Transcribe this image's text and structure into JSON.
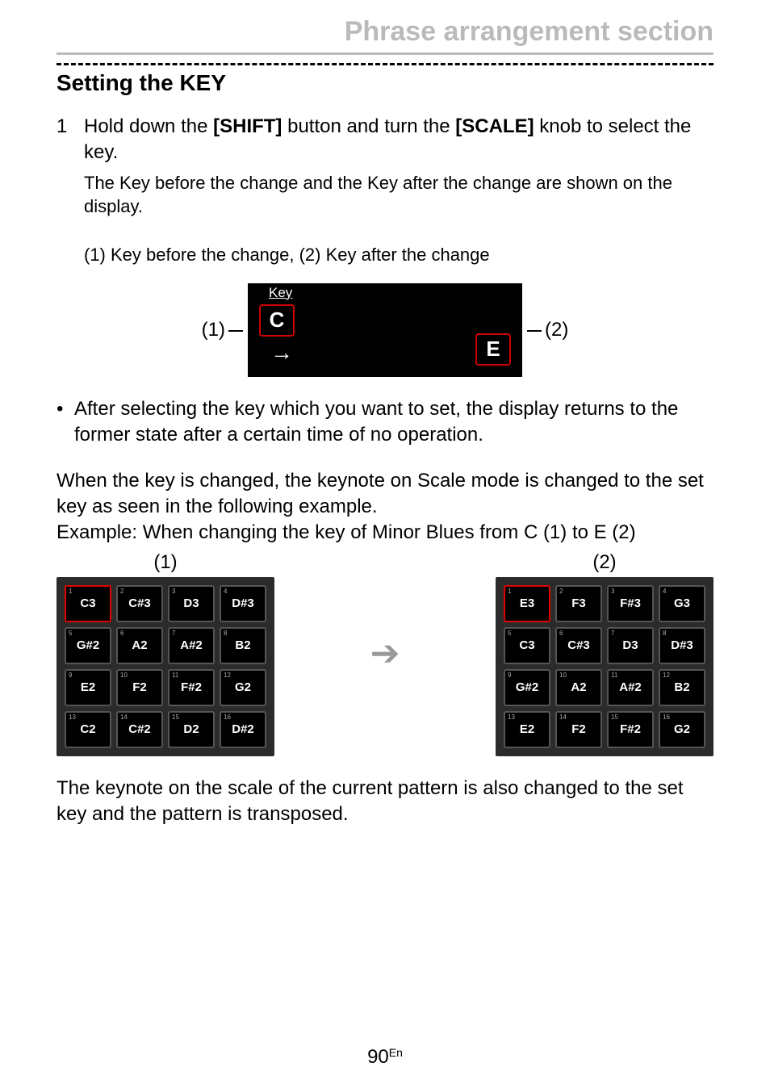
{
  "header": {
    "title": "Phrase arrangement section"
  },
  "section": {
    "title": "Setting the KEY"
  },
  "step1": {
    "num": "1",
    "text_before_shift": "Hold down the ",
    "btn_shift": "[SHIFT]",
    "text_mid": " button and turn the ",
    "btn_scale": "[SCALE]",
    "text_after": " knob to select the key.",
    "desc": "The Key before the change and the Key after the change are shown on the display.",
    "legend": "(1) Key before the change, (2) Key after the change"
  },
  "key_display": {
    "left_callout": "(1)",
    "right_callout": "(2)",
    "label": "Key",
    "key_before": "C",
    "key_after": "E",
    "arrow": "→"
  },
  "bullet": {
    "dot": "•",
    "text": "After selecting the key which you want to set, the display returns to the former state after a certain time of no operation."
  },
  "para1": "When the key is changed, the keynote on Scale mode is changed to the set key as seen in the following example.",
  "para2": "Example: When changing the key of Minor Blues from C (1) to E (2)",
  "grids": {
    "label1": "(1)",
    "label2": "(2)",
    "arrow": "➔",
    "padnums": [
      "1",
      "2",
      "3",
      "4",
      "5",
      "6",
      "7",
      "8",
      "9",
      "10",
      "11",
      "12",
      "13",
      "14",
      "15",
      "16"
    ],
    "grid1": [
      "C3",
      "C#3",
      "D3",
      "D#3",
      "G#2",
      "A2",
      "A#2",
      "B2",
      "E2",
      "F2",
      "F#2",
      "G2",
      "C2",
      "C#2",
      "D2",
      "D#2"
    ],
    "grid1_sel": [
      true,
      false,
      false,
      false,
      false,
      false,
      false,
      false,
      false,
      false,
      false,
      false,
      false,
      false,
      false,
      false
    ],
    "grid2": [
      "E3",
      "F3",
      "F#3",
      "G3",
      "C3",
      "C#3",
      "D3",
      "D#3",
      "G#2",
      "A2",
      "A#2",
      "B2",
      "E2",
      "F2",
      "F#2",
      "G2"
    ],
    "grid2_sel": [
      true,
      false,
      false,
      false,
      false,
      false,
      false,
      false,
      false,
      false,
      false,
      false,
      false,
      false,
      false,
      false
    ]
  },
  "para3": "The keynote on the scale of the current pattern is also changed to the set key and the pattern is transposed.",
  "footer": {
    "page": "90",
    "suffix": "En"
  }
}
